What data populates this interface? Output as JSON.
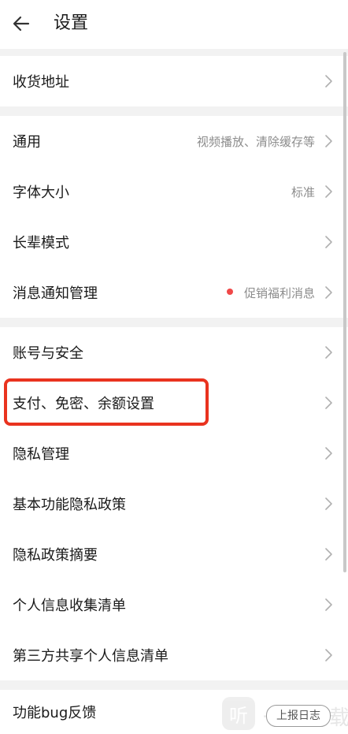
{
  "header": {
    "title": "设置"
  },
  "groups": [
    {
      "items": [
        {
          "label": "收货地址",
          "value": ""
        }
      ]
    },
    {
      "items": [
        {
          "label": "通用",
          "value": "视频播放、清除缓存等"
        },
        {
          "label": "字体大小",
          "value": "标准"
        },
        {
          "label": "长辈模式",
          "value": ""
        },
        {
          "label": "消息通知管理",
          "value": "促销福利消息"
        }
      ]
    },
    {
      "items": [
        {
          "label": "账号与安全",
          "value": ""
        },
        {
          "label": "支付、免密、余额设置",
          "value": ""
        },
        {
          "label": "隐私管理",
          "value": ""
        },
        {
          "label": "基本功能隐私政策",
          "value": ""
        },
        {
          "label": "隐私政策摘要",
          "value": ""
        },
        {
          "label": "个人信息收集清单",
          "value": ""
        },
        {
          "label": "第三方共享个人信息清单",
          "value": ""
        }
      ]
    },
    {
      "items": [
        {
          "label": "功能bug反馈",
          "value": "上报日志"
        }
      ]
    }
  ],
  "watermark": {
    "glyph": "听",
    "text": "一听下载"
  },
  "colors": {
    "background_gap": "#f2f2f2",
    "highlight": "#e9331f",
    "notification_dot": "#f04848",
    "secondary_text": "#8c8c8c"
  }
}
